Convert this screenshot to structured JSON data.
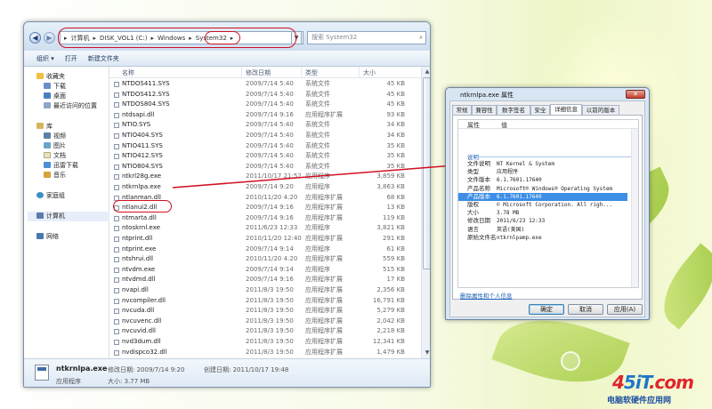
{
  "explorer": {
    "breadcrumb": [
      "计算机",
      "DISK_VOL1 (C:)",
      "Windows",
      "System32"
    ],
    "search_placeholder": "搜索 System32",
    "toolbar": {
      "organize": "组织 ▾",
      "open": "打开",
      "new_folder": "新建文件夹"
    },
    "nav": {
      "favorites": "收藏夹",
      "downloads": "下载",
      "desktop": "桌面",
      "recent": "最近访问的位置",
      "libraries": "库",
      "videos": "视频",
      "pictures": "图片",
      "documents": "文档",
      "xunlei": "迅雷下载",
      "music": "音乐",
      "homegroup": "家庭组",
      "computer": "计算机",
      "network": "网络"
    },
    "columns": {
      "name": "名称",
      "date": "修改日期",
      "type": "类型",
      "size": "大小"
    },
    "files": [
      {
        "name": "NTDOS411.SYS",
        "date": "2009/7/14 5:40",
        "type": "系统文件",
        "size": "45 KB"
      },
      {
        "name": "NTDOS412.SYS",
        "date": "2009/7/14 5:40",
        "type": "系统文件",
        "size": "45 KB"
      },
      {
        "name": "NTDOS804.SYS",
        "date": "2009/7/14 5:40",
        "type": "系统文件",
        "size": "45 KB"
      },
      {
        "name": "ntdsapi.dll",
        "date": "2009/7/14 9:16",
        "type": "应用程序扩展",
        "size": "93 KB"
      },
      {
        "name": "NTIO.SYS",
        "date": "2009/7/14 5:40",
        "type": "系统文件",
        "size": "34 KB"
      },
      {
        "name": "NTIO404.SYS",
        "date": "2009/7/14 5:40",
        "type": "系统文件",
        "size": "34 KB"
      },
      {
        "name": "NTIO411.SYS",
        "date": "2009/7/14 5:40",
        "type": "系统文件",
        "size": "35 KB"
      },
      {
        "name": "NTIO412.SYS",
        "date": "2009/7/14 5:40",
        "type": "系统文件",
        "size": "35 KB"
      },
      {
        "name": "NTIO804.SYS",
        "date": "2009/7/14 5:40",
        "type": "系统文件",
        "size": "35 KB"
      },
      {
        "name": "ntkrl28g.exe",
        "date": "2011/10/17 21:52",
        "type": "应用程序",
        "size": "3,859 KB"
      },
      {
        "name": "ntkrnlpa.exe",
        "date": "2009/7/14 9:20",
        "type": "应用程序",
        "size": "3,863 KB"
      },
      {
        "name": "ntlanman.dll",
        "date": "2010/11/20 4:20",
        "type": "应用程序扩展",
        "size": "68 KB"
      },
      {
        "name": "ntlanui2.dll",
        "date": "2009/7/14 9:16",
        "type": "应用程序扩展",
        "size": "13 KB"
      },
      {
        "name": "ntmarta.dll",
        "date": "2009/7/14 9:16",
        "type": "应用程序扩展",
        "size": "119 KB"
      },
      {
        "name": "ntoskrnl.exe",
        "date": "2011/6/23 12:33",
        "type": "应用程序",
        "size": "3,821 KB"
      },
      {
        "name": "ntprint.dll",
        "date": "2010/11/20 12:40",
        "type": "应用程序扩展",
        "size": "291 KB"
      },
      {
        "name": "ntprint.exe",
        "date": "2009/7/14 9:14",
        "type": "应用程序",
        "size": "61 KB"
      },
      {
        "name": "ntshrui.dll",
        "date": "2010/11/20 4:20",
        "type": "应用程序扩展",
        "size": "559 KB"
      },
      {
        "name": "ntvdm.exe",
        "date": "2009/7/14 9:14",
        "type": "应用程序",
        "size": "515 KB"
      },
      {
        "name": "ntvdmd.dll",
        "date": "2009/7/14 9:16",
        "type": "应用程序扩展",
        "size": "17 KB"
      },
      {
        "name": "nvapi.dll",
        "date": "2011/8/3 19:50",
        "type": "应用程序扩展",
        "size": "2,356 KB"
      },
      {
        "name": "nvcompiler.dll",
        "date": "2011/8/3 19:50",
        "type": "应用程序扩展",
        "size": "16,791 KB"
      },
      {
        "name": "nvcuda.dll",
        "date": "2011/8/3 19:50",
        "type": "应用程序扩展",
        "size": "5,279 KB"
      },
      {
        "name": "nvcuvenc.dll",
        "date": "2011/8/3 19:50",
        "type": "应用程序扩展",
        "size": "2,042 KB"
      },
      {
        "name": "nvcuvid.dll",
        "date": "2011/8/3 19:50",
        "type": "应用程序扩展",
        "size": "2,218 KB"
      },
      {
        "name": "nvd3dum.dll",
        "date": "2011/8/3 19:50",
        "type": "应用程序扩展",
        "size": "12,341 KB"
      },
      {
        "name": "nvdispco32.dll",
        "date": "2011/8/3 19:50",
        "type": "应用程序扩展",
        "size": "1,479 KB"
      }
    ],
    "details": {
      "filename": "ntkrnlpa.exe",
      "type": "应用程序",
      "modified": "修改日期: 2009/7/14 9:20",
      "created": "创建日期: 2011/10/17 19:48",
      "size": "大小: 3.77 MB"
    }
  },
  "properties": {
    "title": "ntkrnlpa.exe 属性",
    "close": "✕",
    "tabs": [
      "常规",
      "兼容性",
      "数字签名",
      "安全",
      "详细信息",
      "以前的版本"
    ],
    "active_tab": "详细信息",
    "col_property": "属性",
    "col_value": "值",
    "group": "说明",
    "rows": [
      {
        "name": "文件说明",
        "value": "NT Kernel & System"
      },
      {
        "name": "类型",
        "value": "应用程序"
      },
      {
        "name": "文件版本",
        "value": "6.1.7601.17640"
      },
      {
        "name": "产品名称",
        "value": "Microsoft® Windows® Operating System"
      },
      {
        "name": "产品版本",
        "value": "6.1.7601.17640",
        "selected": true
      },
      {
        "name": "版权",
        "value": "© Microsoft Corporation. All righ..."
      },
      {
        "name": "大小",
        "value": "3.78 MB"
      },
      {
        "name": "修改日期",
        "value": "2011/6/23 12:33"
      },
      {
        "name": "语言",
        "value": "英语(美国)"
      },
      {
        "name": "原始文件名",
        "value": "ntkrnlpamp.exe"
      }
    ],
    "remove_link": "删除属性和个人信息",
    "buttons": {
      "ok": "确定",
      "cancel": "取消",
      "apply": "应用(A)"
    }
  },
  "watermark": {
    "logo_part1": "4",
    "logo_part2": "5iT",
    "logo_part3": ".com",
    "caption": "电脑软硬件应用网"
  },
  "colors": {
    "highlight": "#d01020",
    "selection": "#3d8ee6",
    "link": "#1a5fb4"
  }
}
